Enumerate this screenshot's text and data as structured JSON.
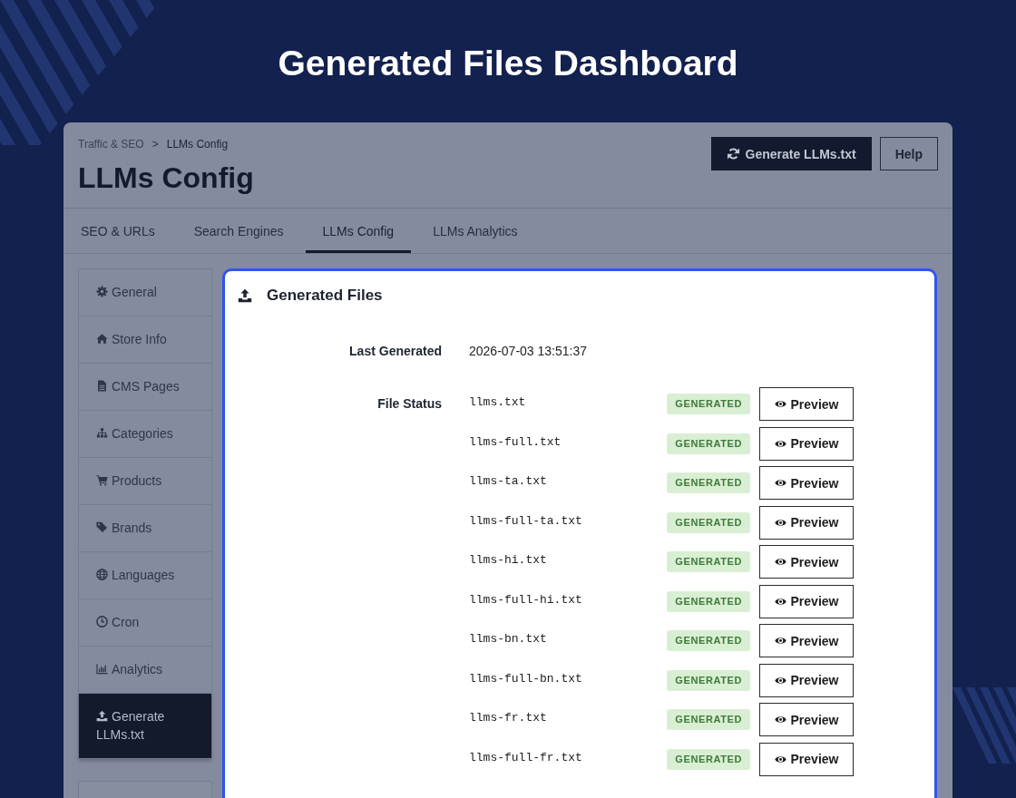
{
  "header": {
    "title": "Generated Files Dashboard"
  },
  "page": {
    "breadcrumb": {
      "items": [
        "Traffic & SEO",
        "LLMs Config"
      ],
      "separator": ">"
    },
    "title": "LLMs Config",
    "actions": [
      {
        "label": "Generate LLMs.txt",
        "kind": "primary"
      },
      {
        "label": "Help",
        "kind": "secondary"
      }
    ]
  },
  "tabs": [
    {
      "label": "SEO & URLs",
      "selected": false
    },
    {
      "label": "Search Engines",
      "selected": false
    },
    {
      "label": "LLMs Config",
      "selected": true
    },
    {
      "label": "LLMs Analytics",
      "selected": false
    }
  ],
  "sidebar": {
    "items": [
      {
        "label": "General",
        "selected": false
      },
      {
        "label": "Store Info",
        "selected": false
      },
      {
        "label": "CMS Pages",
        "selected": false
      },
      {
        "label": "Categories",
        "selected": false
      },
      {
        "label": "Products",
        "selected": false
      },
      {
        "label": "Brands",
        "selected": false
      },
      {
        "label": "Languages",
        "selected": false
      },
      {
        "label": "Cron",
        "selected": false
      },
      {
        "label": "Analytics",
        "selected": false
      },
      {
        "label": "Generate LLMs.txt",
        "selected": true
      }
    ]
  },
  "card": {
    "title": "Generated Files",
    "last_generated": {
      "label": "Last Generated",
      "value": "2026-07-03 13:51:37"
    },
    "file_status": {
      "label": "File Status",
      "files": [
        {
          "name": "llms.txt",
          "status": "GENERATED",
          "action": "Preview"
        },
        {
          "name": "llms-full.txt",
          "status": "GENERATED",
          "action": "Preview"
        },
        {
          "name": "llms-ta.txt",
          "status": "GENERATED",
          "action": "Preview"
        },
        {
          "name": "llms-full-ta.txt",
          "status": "GENERATED",
          "action": "Preview"
        },
        {
          "name": "llms-hi.txt",
          "status": "GENERATED",
          "action": "Preview"
        },
        {
          "name": "llms-full-hi.txt",
          "status": "GENERATED",
          "action": "Preview"
        },
        {
          "name": "llms-bn.txt",
          "status": "GENERATED",
          "action": "Preview"
        },
        {
          "name": "llms-full-bn.txt",
          "status": "GENERATED",
          "action": "Preview"
        },
        {
          "name": "llms-fr.txt",
          "status": "GENERATED",
          "action": "Preview"
        },
        {
          "name": "llms-full-fr.txt",
          "status": "GENERATED",
          "action": "Preview"
        }
      ]
    }
  }
}
